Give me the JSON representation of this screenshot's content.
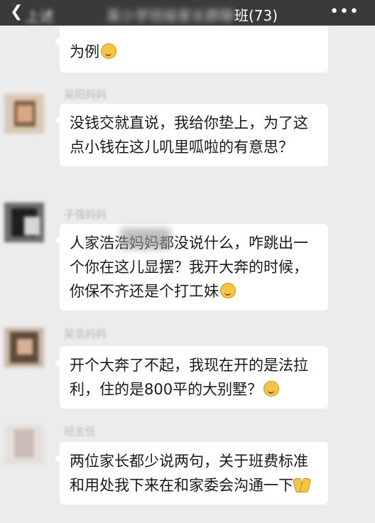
{
  "header": {
    "back_icon": "chevron-left-icon",
    "back_text": "上述",
    "title_blurred": "某小学班级家长群聊",
    "title_count": "班(73)",
    "more_icon": "more-dots-icon"
  },
  "messages": [
    {
      "sender": "",
      "text": "为例",
      "emoji": "smile-emoji"
    },
    {
      "sender": "吴阳妈妈",
      "text": "没钱交就直说，我给你垫上，为了这点小钱在这儿叽里呱啦的有意思？"
    },
    {
      "sender": "子强妈妈",
      "text": "人家浩浩妈妈都没说什么，咋跳出一个你在这儿显摆？我开大奔的时候，你保不齐还是个打工妹",
      "emoji": "smirk-emoji"
    },
    {
      "sender": "吴浩妈妈",
      "text": "开个大奔了不起，我现在开的是法拉利，住的是800平的大别墅？",
      "emoji": "kiss-emoji"
    },
    {
      "sender": "班主任",
      "text": "两位家长都少说两句，关于班费标准和用处我下来在和家委会沟通一下",
      "emoji": "pray-hands-emoji"
    }
  ]
}
